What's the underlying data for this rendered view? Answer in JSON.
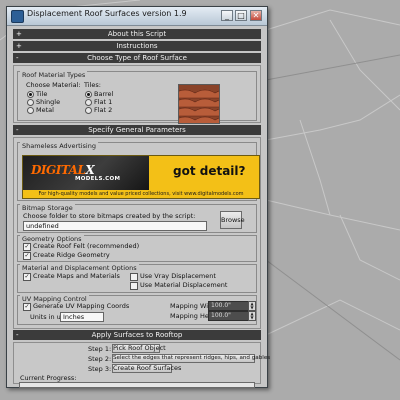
{
  "window": {
    "title": "Displacement Roof Surfaces version 1.9"
  },
  "rollouts": {
    "about": {
      "sign": "+",
      "label": "About this Script"
    },
    "instructions": {
      "sign": "+",
      "label": "Instructions"
    },
    "choose_type": {
      "sign": "-",
      "label": "Choose Type of Roof Surface"
    },
    "general_params": {
      "sign": "-",
      "label": "Specify General Parameters"
    },
    "apply": {
      "sign": "-",
      "label": "Apply Surfaces to Rooftop"
    }
  },
  "roof_material_types": {
    "group_label": "Roof Material Types",
    "material_heading": "Choose Material:",
    "materials": [
      "Tile",
      "Shingle",
      "Metal"
    ],
    "selected_material": "Tile",
    "tiles_heading": "Tiles:",
    "tiles": [
      "Barrel",
      "Flat 1",
      "Flat 2"
    ],
    "selected_tile": "Barrel"
  },
  "advertising": {
    "group_label": "Shameless Advertising",
    "logo": "DIGITAL",
    "logo_accent": "X",
    "logo_sub": "MODELS.COM",
    "headline": "got detail?",
    "tagline": "For high-quality models and value priced collections, visit www.digitalmodels.com"
  },
  "bitmap_storage": {
    "group_label": "Bitmap Storage",
    "prompt": "Choose folder to store bitmaps created by the script:",
    "path_value": "undefined",
    "browse_label": "Browse"
  },
  "geometry_options": {
    "group_label": "Geometry Options",
    "create_roof_felt": {
      "label": "Create Roof Felt (recommended)",
      "checked": true
    },
    "create_ridge_geometry": {
      "label": "Create Ridge Geometry",
      "checked": true
    }
  },
  "material_displacement": {
    "group_label": "Material and Displacement Options",
    "create_maps": {
      "label": "Create Maps and Materials",
      "checked": true
    },
    "use_vray": {
      "label": "Use Vray Displacement",
      "checked": false
    },
    "use_material_disp": {
      "label": "Use Material Displacement",
      "checked": false
    }
  },
  "uv_mapping": {
    "group_label": "UV Mapping Control",
    "generate_uv": {
      "label": "Generate UV Mapping Coords",
      "checked": true
    },
    "units_label": "Units in use:",
    "units_value": "Inches",
    "width_label": "Mapping Width:",
    "width_value": "100.0\"",
    "height_label": "Mapping Height:",
    "height_value": "100.0\""
  },
  "apply": {
    "step1_label": "Step 1:",
    "step1_button": "Pick Roof Object",
    "step2_label": "Step 2:",
    "step2_button": "Select the edges that represent ridges, hips, and gables",
    "step3_label": "Step 3:",
    "step3_button": "Create Roof Surfaces",
    "progress_label": "Current Progress:",
    "progress_value": 0
  },
  "colors": {
    "window_bg": "#c6c6c6",
    "rollout_bar": "#3b3b3b",
    "ad_yellow": "#f3c017",
    "ad_logo_orange": "#ff6a00"
  }
}
